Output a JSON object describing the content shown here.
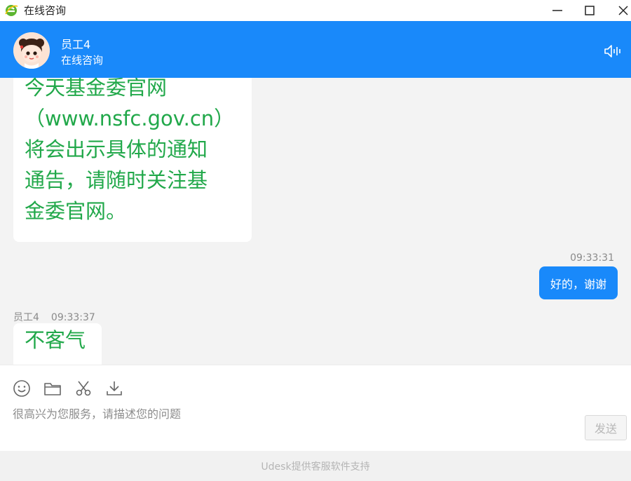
{
  "window": {
    "title": "在线咨询",
    "icon": "ie-browser-icon",
    "controls": [
      "minimize-icon",
      "maximize-icon",
      "close-icon"
    ]
  },
  "header": {
    "agent_name": "员工4",
    "status": "在线咨询",
    "speaker_icon": "speaker-icon",
    "bg_color": "#1989fa"
  },
  "messages": [
    {
      "side": "left",
      "lines": [
        "今天基金委官网",
        "（www.nsfc.gov.cn）",
        "将会出示具体的通知",
        "通告，请随时关注基",
        "金委官网。"
      ],
      "color": "#21a84a"
    },
    {
      "side": "right",
      "time": "09:33:31",
      "text": "好的，谢谢"
    },
    {
      "side": "left",
      "sender": "员工4",
      "time": "09:33:37",
      "text": "不客气"
    }
  ],
  "composer": {
    "tools": [
      "emoji-icon",
      "folder-icon",
      "scissors-icon",
      "download-icon"
    ],
    "placeholder": "很高兴为您服务，请描述您的问题",
    "send_label": "发送"
  },
  "footer": {
    "text": "Udesk提供客服软件支持"
  }
}
